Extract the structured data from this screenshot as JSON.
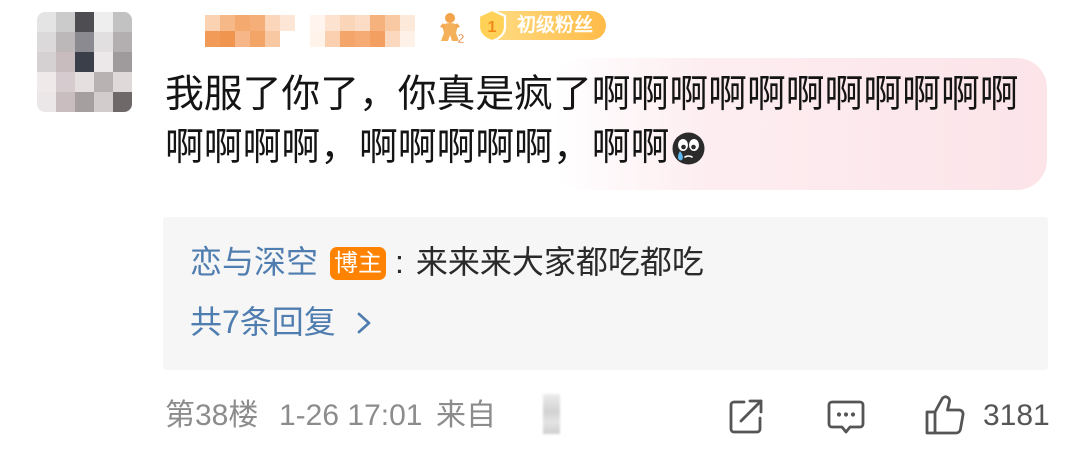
{
  "colors": {
    "text_primary": "#141414",
    "text_muted": "#8c8c8c",
    "link_blue": "#507daf",
    "author_badge_bg": "#ff8200",
    "highlight_pink": "#fce4e9",
    "reply_bg": "#f6f6f6",
    "icon_gray": "#555555"
  },
  "comment": {
    "level_icon": {
      "icon": "user-level-icon",
      "number": "2"
    },
    "fan_badge": {
      "icon": "fan-level-shield-icon",
      "level": "1",
      "label": "初级粉丝"
    },
    "text_lines": [
      "我服了你了，你真是疯了啊啊啊啊啊啊啊啊啊啊啊",
      "啊啊啊啊，啊啊啊啊啊，啊啊"
    ],
    "emoji_icon": "crying-face-emoji-icon"
  },
  "reply_preview": {
    "author": "恋与深空",
    "author_badge": "博主",
    "separator": ":",
    "text": "来来来大家都吃都吃",
    "more_label": "共7条回复",
    "more_icon": "chevron-right-icon"
  },
  "footer": {
    "floor": "第38楼",
    "time": "1-26 17:01",
    "source_label": "来自",
    "actions": {
      "repost_icon": "repost-icon",
      "comment_icon": "comment-icon",
      "like_icon": "thumb-up-icon",
      "like_count": "3181"
    }
  }
}
